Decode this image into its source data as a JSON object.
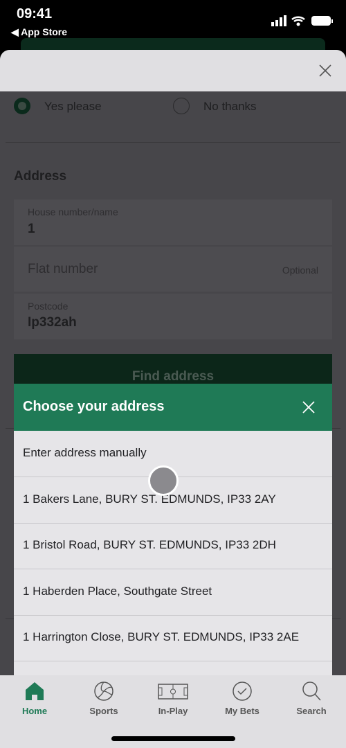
{
  "status_bar": {
    "time": "09:41",
    "back_label": "◀ App Store"
  },
  "form": {
    "radio_yes": "Yes please",
    "radio_no": "No thanks",
    "selected": "yes",
    "address_heading": "Address",
    "house_label": "House number/name",
    "house_value": "1",
    "flat_placeholder": "Flat number",
    "flat_hint": "Optional",
    "postcode_label": "Postcode",
    "postcode_value": "Ip332ah",
    "find_button": "Find address"
  },
  "modal": {
    "title": "Choose your address",
    "items": [
      {
        "label": "Enter address manually"
      },
      {
        "label": "1 Bakers Lane, BURY ST. EDMUNDS, IP33 2AY"
      },
      {
        "label": "1 Bristol Road, BURY ST. EDMUNDS, IP33 2DH"
      },
      {
        "label": "1 Haberden Place, Southgate Street"
      },
      {
        "label": "1 Harrington Close, BURY ST. EDMUNDS, IP33 2AE"
      }
    ]
  },
  "tabbar": {
    "items": [
      {
        "label": "Home",
        "icon": "home-icon",
        "active": true
      },
      {
        "label": "Sports",
        "icon": "ball-icon"
      },
      {
        "label": "In-Play",
        "icon": "pitch-icon"
      },
      {
        "label": "My Bets",
        "icon": "check-circle-icon"
      },
      {
        "label": "Search",
        "icon": "search-icon"
      }
    ]
  },
  "colors": {
    "brand_green": "#1f7a56",
    "active_tab": "#1f7a56"
  }
}
